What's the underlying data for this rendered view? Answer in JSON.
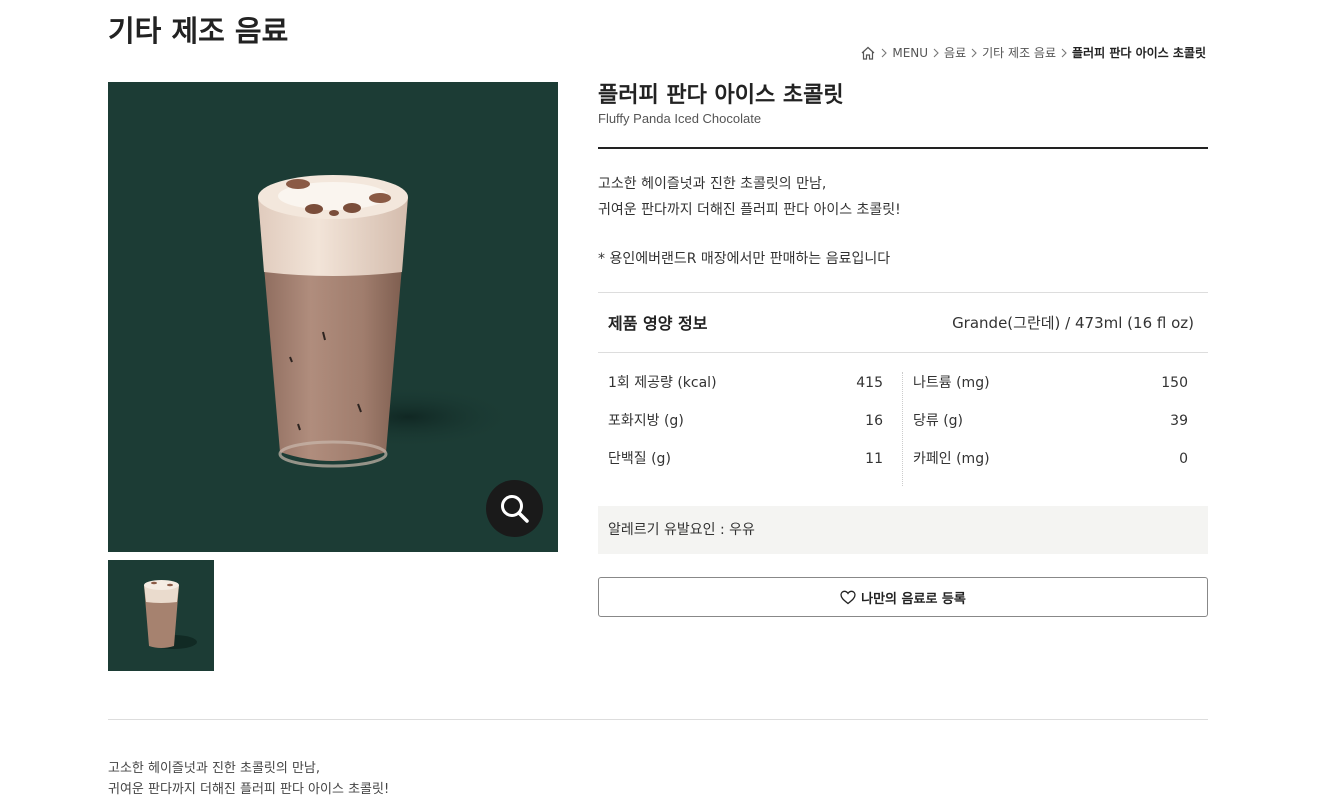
{
  "page": {
    "title": "기타 제조 음료"
  },
  "breadcrumb": {
    "items": [
      "MENU",
      "음료",
      "기타 제조 음료",
      "플러피 판다 아이스 초콜릿"
    ]
  },
  "product": {
    "name_ko": "플러피 판다 아이스 초콜릿",
    "name_en": "Fluffy Panda Iced Chocolate",
    "description": [
      "고소한 헤이즐넛과 진한 초콜릿의 만남,",
      "귀여운 판다까지 더해진 플러피 판다 아이스 초콜릿!"
    ],
    "notice": "* 용인에버랜드R 매장에서만 판매하는 음료입니다"
  },
  "nutrition": {
    "title": "제품 영양 정보",
    "size": "Grande(그란데) / 473ml (16 fl oz)",
    "left": [
      {
        "label": "1회 제공량 (kcal)",
        "value": "415"
      },
      {
        "label": "포화지방 (g)",
        "value": "16"
      },
      {
        "label": "단백질 (g)",
        "value": "11"
      }
    ],
    "right": [
      {
        "label": "나트륨 (mg)",
        "value": "150"
      },
      {
        "label": "당류 (g)",
        "value": "39"
      },
      {
        "label": "카페인 (mg)",
        "value": "0"
      }
    ]
  },
  "allergy": {
    "text": "알레르기 유발요인 : 우유"
  },
  "actions": {
    "favorite_label": "나만의 음료로 등록"
  },
  "bottom": {
    "description": [
      "고소한 헤이즐넛과 진한 초콜릿의 만남,",
      "귀여운 판다까지 더해진 플러피 판다 아이스 초콜릿!"
    ]
  },
  "colors": {
    "photo_bg": "#1c3c35",
    "allergy_bg": "#f4f4f2",
    "text": "#222222"
  },
  "icons": {
    "home": "home-icon",
    "zoom": "magnifier-icon",
    "favorite": "heart-icon",
    "separator": "chevron-right-icon"
  }
}
